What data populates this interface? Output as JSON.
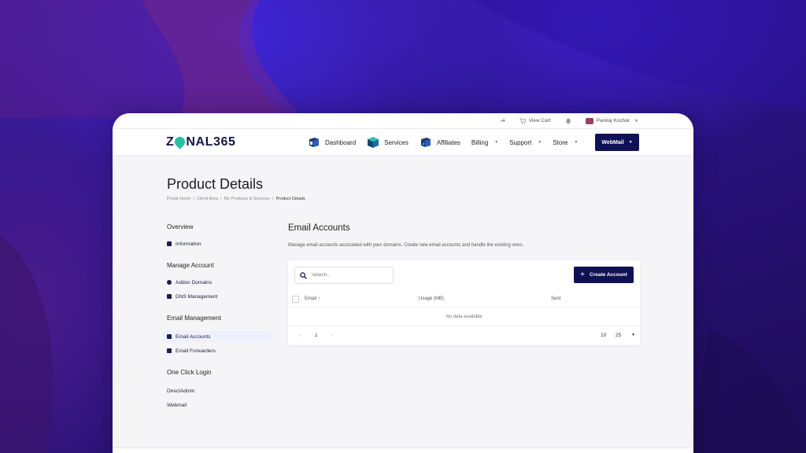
{
  "colors": {
    "brand_navy": "#101154",
    "logo_accent": "#28c0a0",
    "background_purple": "#2a1478"
  },
  "topbar": {
    "view_cart": "View Cart",
    "user_name": "Pankaj Kochar"
  },
  "navbar": {
    "logo_left": "Z",
    "logo_right": "NAL365",
    "items": [
      {
        "label": "Dashboard",
        "icon": "dashboard-icon"
      },
      {
        "label": "Services",
        "icon": "box-icon"
      },
      {
        "label": "Affiliates",
        "icon": "affiliates-icon"
      },
      {
        "label": "Billing",
        "has_dropdown": true
      },
      {
        "label": "Support",
        "has_dropdown": true
      },
      {
        "label": "Store",
        "has_dropdown": true
      }
    ],
    "webmail_label": "WebMail"
  },
  "page": {
    "title": "Product Details",
    "breadcrumb": [
      "Portal Home",
      "Client Area",
      "My Products & Services",
      "Product Details"
    ]
  },
  "sidebar": {
    "overview_head": "Overview",
    "information": "Information",
    "manage_head": "Manage Account",
    "addon_domains": "Addon Domains",
    "dns_management": "DNS Management",
    "email_head": "Email Management",
    "email_accounts": "Email Accounts",
    "email_forwarders": "Email Forwarders",
    "login_head": "One Click Login",
    "directadmin": "DirectAdmin",
    "webmail": "Webmail"
  },
  "main": {
    "title": "Email Accounts",
    "description": "Manage email accounts associated with your domains. Create new email accounts and handle the existing ones.",
    "search_placeholder": "Search...",
    "create_label": "Create Account",
    "columns": {
      "email": "Email",
      "usage": "Usage (MB)",
      "sent": "Sent"
    },
    "no_data": "No data available",
    "page": "1",
    "size_10": "10",
    "size_25": "25"
  }
}
